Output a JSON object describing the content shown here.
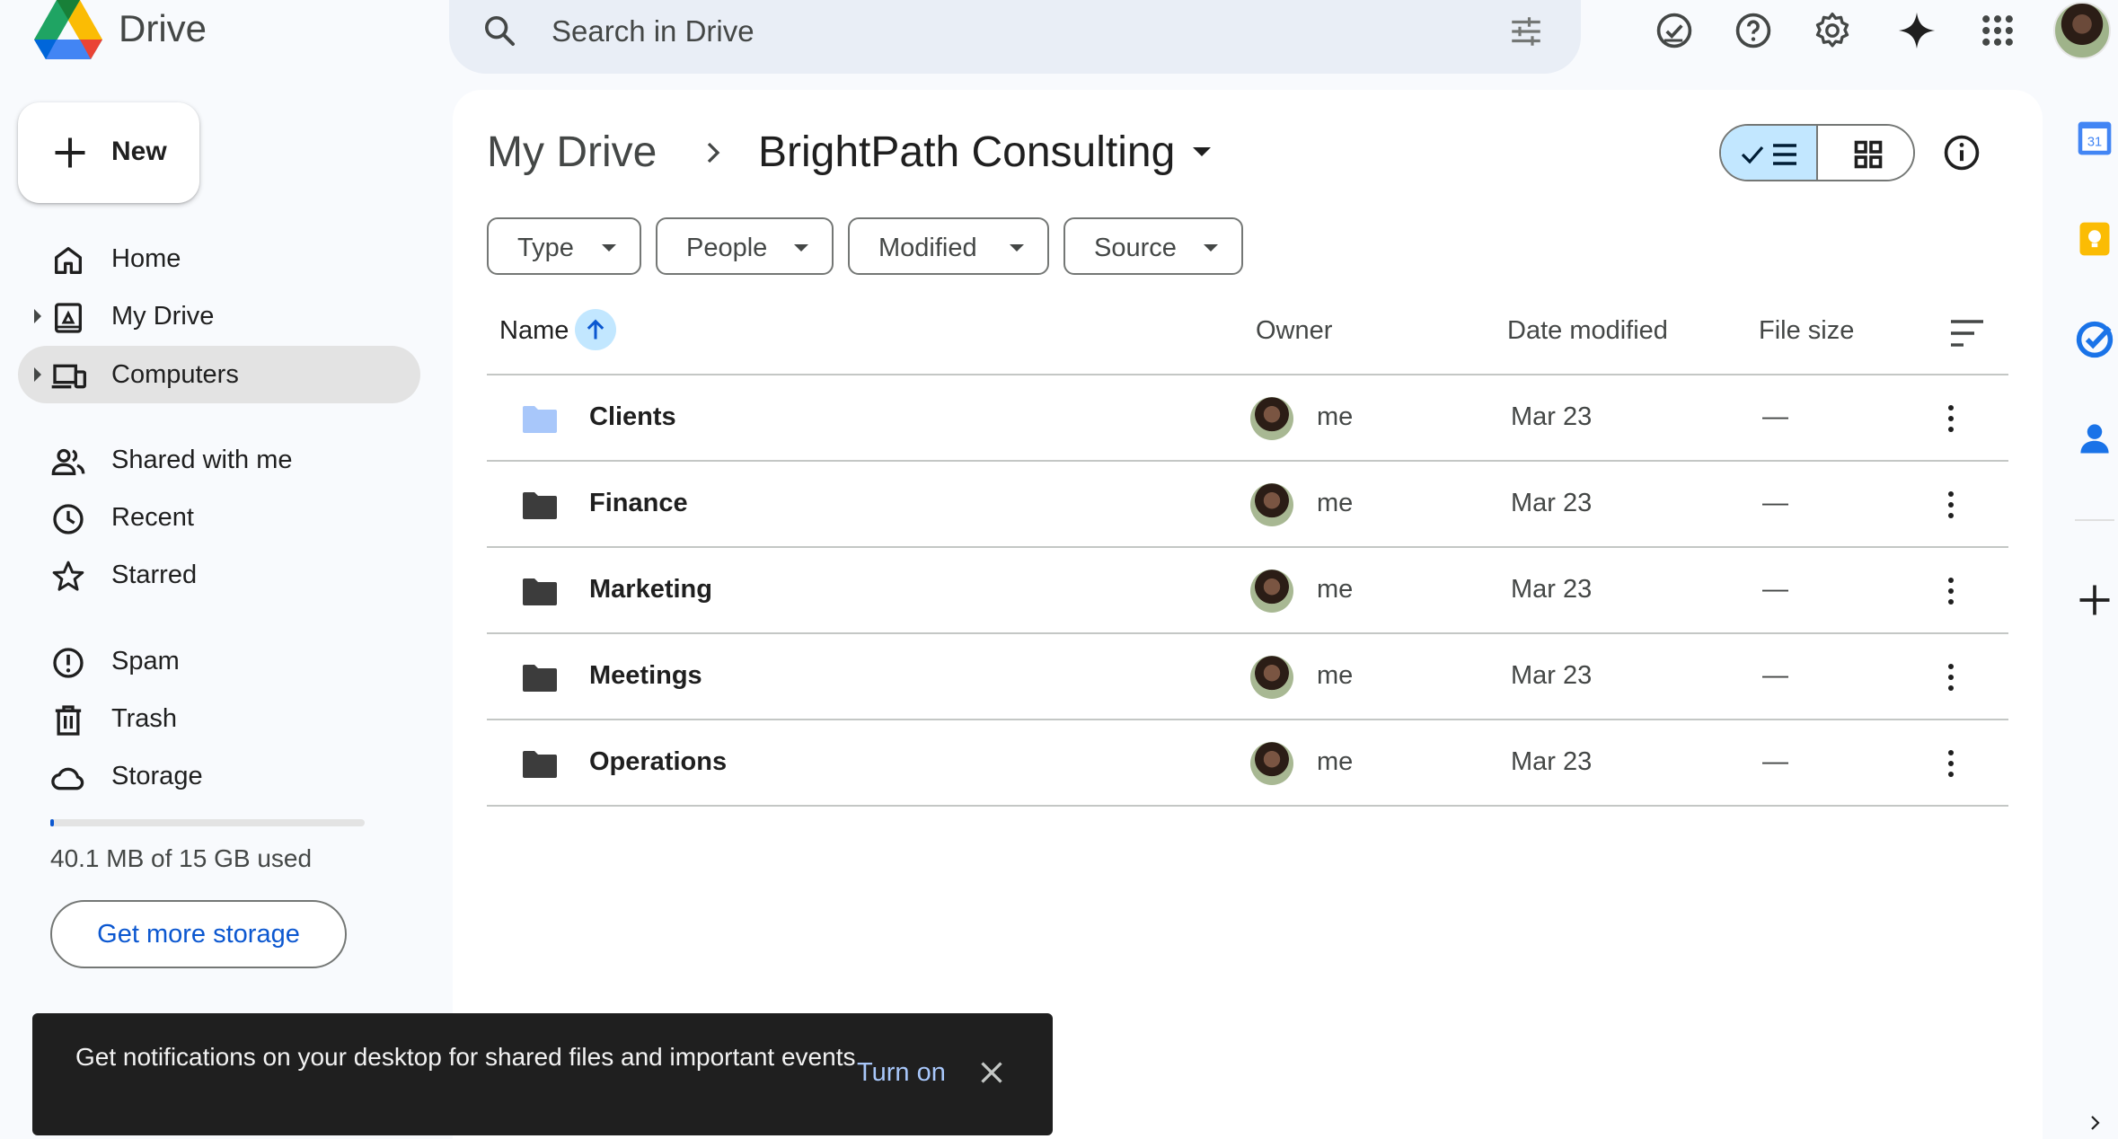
{
  "app": {
    "name": "Drive"
  },
  "search": {
    "placeholder": "Search in Drive"
  },
  "new_button": {
    "label": "New"
  },
  "sidebar": {
    "items": [
      {
        "label": "Home",
        "icon": "home-icon"
      },
      {
        "label": "My Drive",
        "icon": "my-drive-icon"
      },
      {
        "label": "Computers",
        "icon": "computers-icon",
        "active": true
      },
      {
        "label": "Shared with me",
        "icon": "shared-icon"
      },
      {
        "label": "Recent",
        "icon": "clock-icon"
      },
      {
        "label": "Starred",
        "icon": "star-icon"
      },
      {
        "label": "Spam",
        "icon": "spam-icon"
      },
      {
        "label": "Trash",
        "icon": "trash-icon"
      },
      {
        "label": "Storage",
        "icon": "cloud-icon"
      }
    ],
    "storage": {
      "used_text": "40.1 MB of 15 GB used",
      "used_fraction": 0.003,
      "button_label": "Get more storage"
    }
  },
  "breadcrumb": {
    "root": "My Drive",
    "current": "BrightPath Consulting"
  },
  "filters": [
    "Type",
    "People",
    "Modified",
    "Source"
  ],
  "table": {
    "columns": {
      "name": "Name",
      "owner": "Owner",
      "date": "Date modified",
      "size": "File size"
    },
    "rows": [
      {
        "name": "Clients",
        "owner": "me",
        "date": "Mar 23",
        "size": "—",
        "folder_color": "#a8c7fa"
      },
      {
        "name": "Finance",
        "owner": "me",
        "date": "Mar 23",
        "size": "—",
        "folder_color": "#3c3c3c"
      },
      {
        "name": "Marketing",
        "owner": "me",
        "date": "Mar 23",
        "size": "—",
        "folder_color": "#3c3c3c"
      },
      {
        "name": "Meetings",
        "owner": "me",
        "date": "Mar 23",
        "size": "—",
        "folder_color": "#3c3c3c"
      },
      {
        "name": "Operations",
        "owner": "me",
        "date": "Mar 23",
        "size": "—",
        "folder_color": "#3c3c3c"
      }
    ]
  },
  "snackbar": {
    "message": "Get notifications on your desktop for shared files and important events",
    "action": "Turn on"
  },
  "side_panel": {
    "calendar_day": "31"
  },
  "colors": {
    "accent": "#0b57d0",
    "selected": "#c2e7ff",
    "surface": "#f8fafd"
  }
}
